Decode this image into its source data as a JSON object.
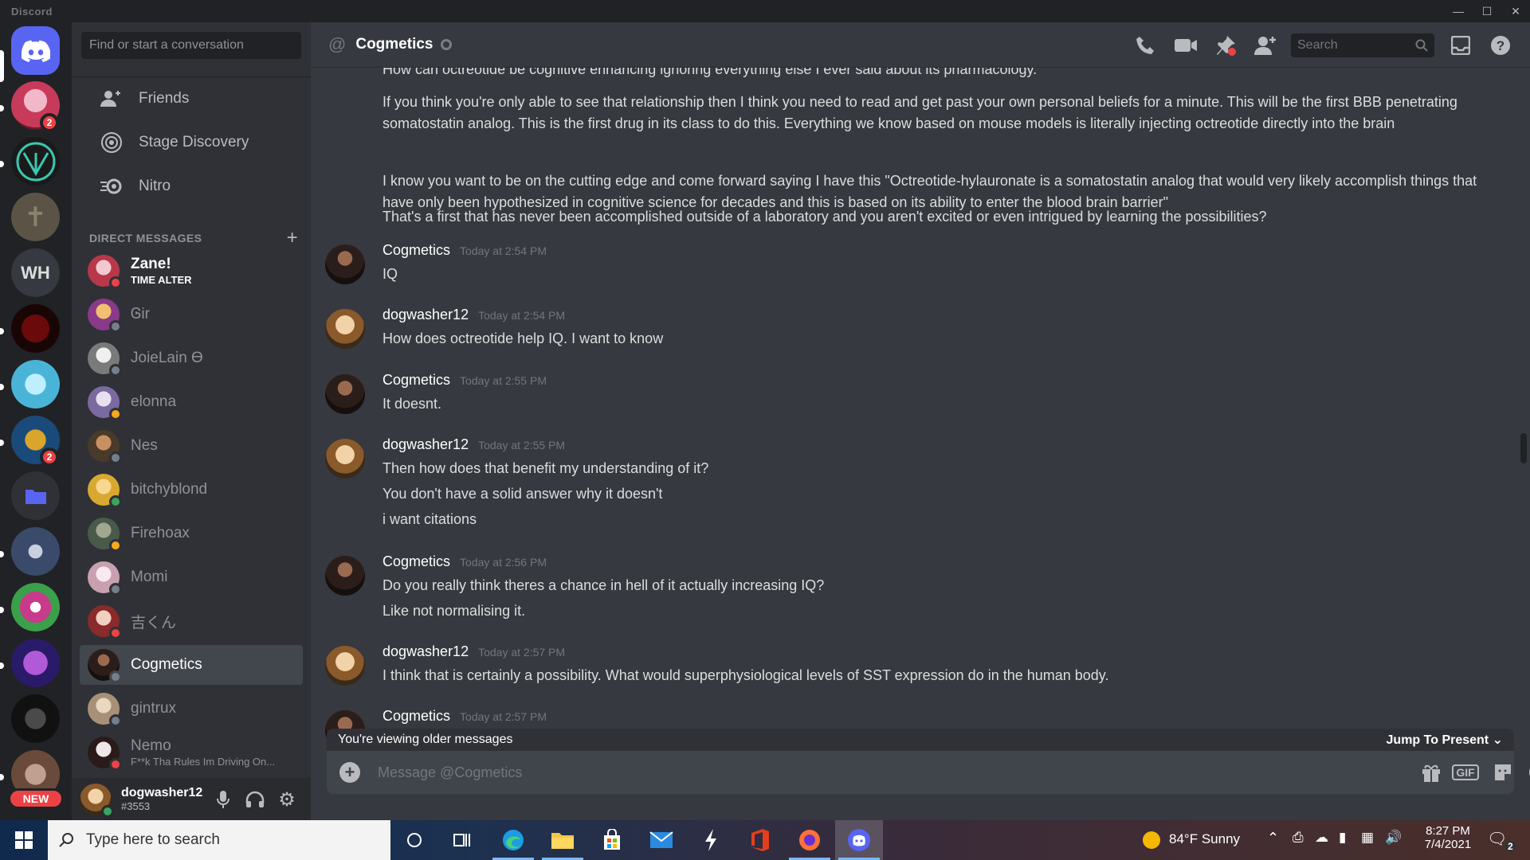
{
  "window": {
    "app_name": "Discord"
  },
  "rail": {
    "badge_1": "2",
    "badge_2": "2",
    "wh_label": "WH",
    "new_label": "NEW"
  },
  "dm_sidebar": {
    "search_placeholder": "Find or start a conversation",
    "nav": [
      {
        "label": "Friends"
      },
      {
        "label": "Stage Discovery"
      },
      {
        "label": "Nitro"
      }
    ],
    "dm_header": "DIRECT MESSAGES",
    "dms": [
      {
        "name": "Zane!",
        "sub": "TIME ALTER",
        "status": "dnd"
      },
      {
        "name": "Ꮆir",
        "sub": "",
        "status": "offline"
      },
      {
        "name": "JoieLain ϴ",
        "sub": "",
        "status": "offline"
      },
      {
        "name": "elonna",
        "sub": "",
        "status": "idle"
      },
      {
        "name": "Nes",
        "sub": "",
        "status": "offline"
      },
      {
        "name": "bitchyblond",
        "sub": "",
        "status": "online"
      },
      {
        "name": "Firehoax",
        "sub": "",
        "status": "idle"
      },
      {
        "name": "Momi",
        "sub": "",
        "status": "offline"
      },
      {
        "name": "吉くん",
        "sub": "",
        "status": "dnd"
      },
      {
        "name": "Cogmetics",
        "sub": "",
        "status": "offline"
      },
      {
        "name": "gintrux",
        "sub": "",
        "status": "offline"
      },
      {
        "name": "Nemo",
        "sub": "F**k Tha Rules Im Driving On...",
        "status": "dnd"
      }
    ],
    "user": {
      "name": "dogwasher12",
      "discriminator": "#3553"
    }
  },
  "channel": {
    "title": "Cogmetics",
    "search_placeholder": "Search"
  },
  "messages": {
    "top_lines": [
      "How can octreotide be cognitive enhancing ignoring everything else I ever said about its pharmacology.",
      "If you think you're only able to see that relationship then I think you need to read and get past your own personal beliefs for a minute. This will be the first BBB penetrating somatostatin analog. This is the first drug in its class to do this. Everything we know based on mouse models is literally injecting octreotide directly into the brain",
      "I know you want to be on the cutting edge and come forward saying I have this \"Octreotide-hylauronate is a somatostatin analog that would very likely accomplish things that have only been hypothesized in cognitive science for decades and this is based on its ability to enter the blood brain barrier\"",
      "That's a first that has never been accomplished outside of a laboratory and you aren't excited or even intrigued by learning the possibilities?"
    ],
    "groups": [
      {
        "author": "Cogmetics",
        "time": "Today at 2:54 PM",
        "lines": [
          "IQ"
        ]
      },
      {
        "author": "dogwasher12",
        "time": "Today at 2:54 PM",
        "lines": [
          "How does octreotide help IQ. I want to know"
        ]
      },
      {
        "author": "Cogmetics",
        "time": "Today at 2:55 PM",
        "lines": [
          "It doesnt."
        ]
      },
      {
        "author": "dogwasher12",
        "time": "Today at 2:55 PM",
        "lines": [
          "Then how does that benefit my understanding of it?",
          "You don't have a solid answer why it doesn't",
          "i want citations"
        ]
      },
      {
        "author": "Cogmetics",
        "time": "Today at 2:56 PM",
        "lines": [
          "Do you really think theres a chance in hell of it actually increasing IQ?",
          "Like not normalising it."
        ]
      },
      {
        "author": "dogwasher12",
        "time": "Today at 2:57 PM",
        "lines": [
          "I think that is certainly a possibility. What would superphysiological levels of SST expression do in the human body."
        ]
      },
      {
        "author": "Cogmetics",
        "time": "Today at 2:57 PM",
        "lines": []
      }
    ]
  },
  "older_bar": {
    "text": "You're viewing older messages",
    "jump": "Jump To Present"
  },
  "composer": {
    "placeholder": "Message @Cogmetics",
    "gif_label": "GIF"
  },
  "taskbar": {
    "search_placeholder": "Type here to search",
    "weather": "84°F  Sunny",
    "time": "8:27 PM",
    "date": "7/4/2021",
    "notif_count": "2"
  }
}
